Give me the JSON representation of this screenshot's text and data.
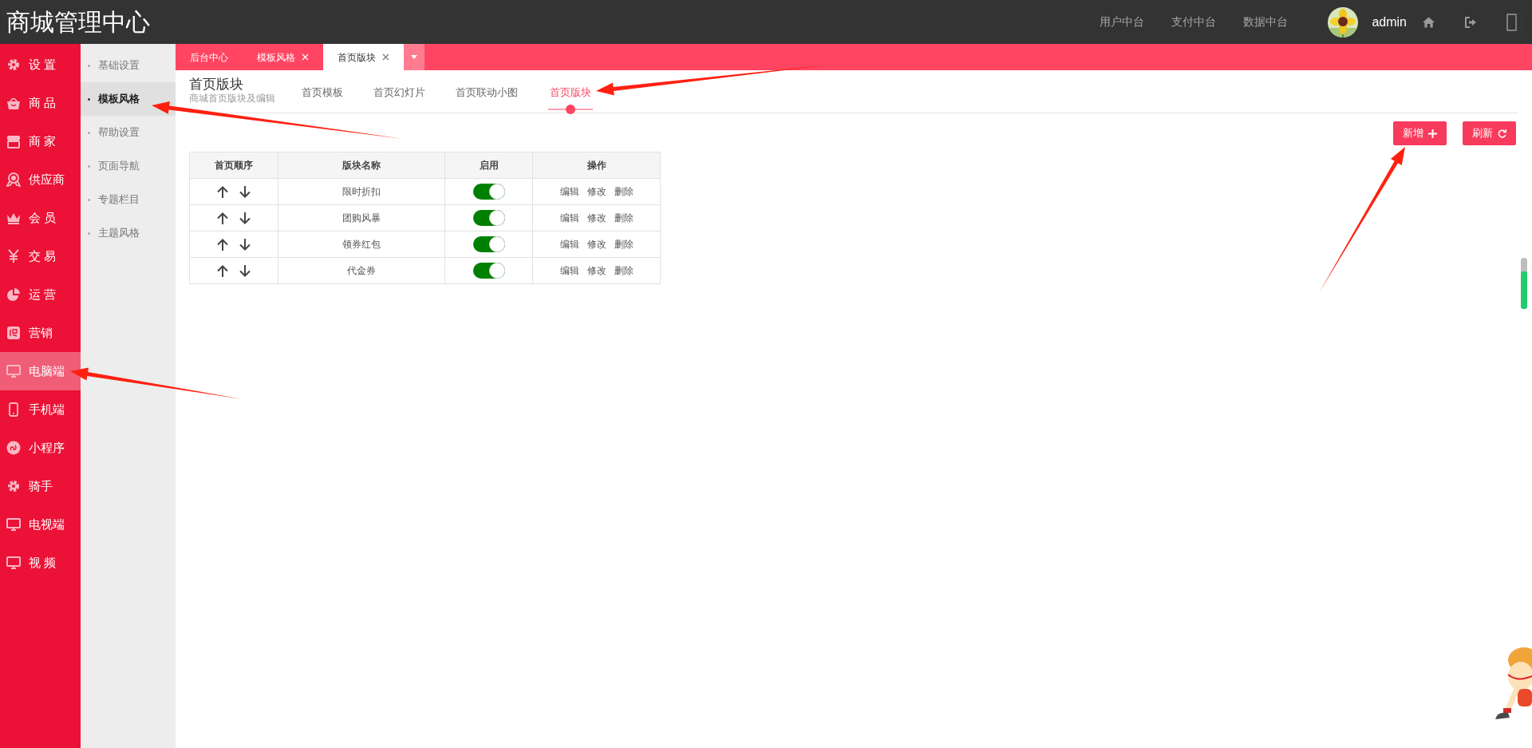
{
  "top_bar": {
    "title": "商城管理中心",
    "links": [
      "用户中台",
      "支付中台",
      "数据中台"
    ],
    "user": "admin"
  },
  "sidebar": {
    "items": [
      {
        "label": "设 置",
        "selected": false
      },
      {
        "label": "商 品",
        "selected": false
      },
      {
        "label": "商 家",
        "selected": false
      },
      {
        "label": "供应商",
        "selected": false
      },
      {
        "label": "会 员",
        "selected": false
      },
      {
        "label": "交 易",
        "selected": false
      },
      {
        "label": "运 营",
        "selected": false
      },
      {
        "label": "营销",
        "selected": false
      },
      {
        "label": "电脑端",
        "selected": true
      },
      {
        "label": "手机端",
        "selected": false
      },
      {
        "label": "小程序",
        "selected": false
      },
      {
        "label": "骑手",
        "selected": false
      },
      {
        "label": "电视端",
        "selected": false
      },
      {
        "label": "视 频",
        "selected": false
      }
    ]
  },
  "subnav": {
    "items": [
      {
        "label": "基础设置",
        "selected": false
      },
      {
        "label": "模板风格",
        "selected": true
      },
      {
        "label": "帮助设置",
        "selected": false
      },
      {
        "label": "页面导航",
        "selected": false
      },
      {
        "label": "专题栏目",
        "selected": false
      },
      {
        "label": "主题风格",
        "selected": false
      }
    ]
  },
  "tabs": [
    {
      "label": "后台中心",
      "selected": false,
      "closable": false
    },
    {
      "label": "模板风格",
      "selected": false,
      "closable": true
    },
    {
      "label": "首页版块",
      "selected": true,
      "closable": true
    }
  ],
  "page_header": {
    "title": "首页版块",
    "subtitle": "商城首页版块及编辑"
  },
  "section_tabs": [
    {
      "label": "首页模板",
      "selected": false
    },
    {
      "label": "首页幻灯片",
      "selected": false
    },
    {
      "label": "首页联动小图",
      "selected": false
    },
    {
      "label": "首页版块",
      "selected": true
    }
  ],
  "buttons": [
    {
      "label": "新增",
      "kind": "add"
    },
    {
      "label": "刷新",
      "kind": "refresh"
    }
  ],
  "table": {
    "columns": [
      "首页顺序",
      "版块名称",
      "启用",
      "操作"
    ],
    "rows": [
      {
        "name": "限时折扣",
        "enabled": true,
        "actions": [
          "编辑",
          "修改",
          "删除"
        ]
      },
      {
        "name": "团购风暴",
        "enabled": true,
        "actions": [
          "编辑",
          "修改",
          "删除"
        ]
      },
      {
        "name": "领券红包",
        "enabled": true,
        "actions": [
          "编辑",
          "修改",
          "删除"
        ]
      },
      {
        "name": "代金券",
        "enabled": true,
        "actions": [
          "编辑",
          "修改",
          "删除"
        ]
      }
    ]
  }
}
